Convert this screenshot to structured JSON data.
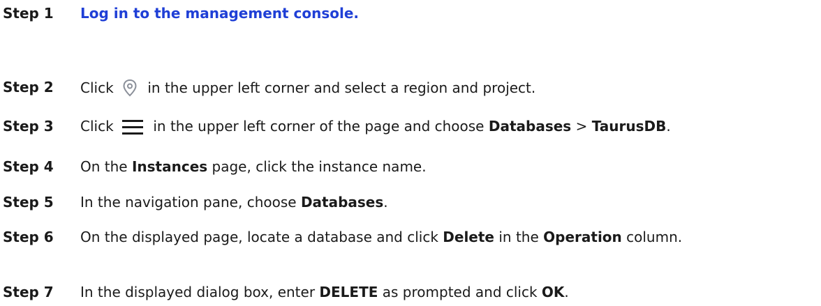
{
  "steps": [
    {
      "label": "Step 1",
      "link": "Log in to the management console."
    },
    {
      "label": "Step 2",
      "pre": "Click",
      "icon": "location-pin-icon",
      "post": "in the upper left corner and select a region and project."
    },
    {
      "label": "Step 3",
      "pre": "Click",
      "icon": "hamburger-menu-icon",
      "mid": "in the upper left corner of the page and choose",
      "b1": "Databases",
      "sep": ">",
      "b2": "TaurusDB",
      "end": "."
    },
    {
      "label": "Step 4",
      "pre": "On the",
      "b1": "Instances",
      "post": "page, click the instance name."
    },
    {
      "label": "Step 5",
      "pre": "In the navigation pane, choose",
      "b1": "Databases",
      "end": "."
    },
    {
      "label": "Step 6",
      "pre": "On the displayed page, locate a database and click",
      "b1": "Delete",
      "mid": "in the",
      "b2": "Operation",
      "post": "column."
    },
    {
      "label": "Step 7",
      "pre": "In the displayed dialog box, enter",
      "b1": "DELETE",
      "mid": "as prompted and click",
      "b2": "OK",
      "end": "."
    }
  ],
  "colors": {
    "link": "#1f3fd6",
    "text": "#1a1a1a",
    "icon_gray": "#8a8f99"
  }
}
